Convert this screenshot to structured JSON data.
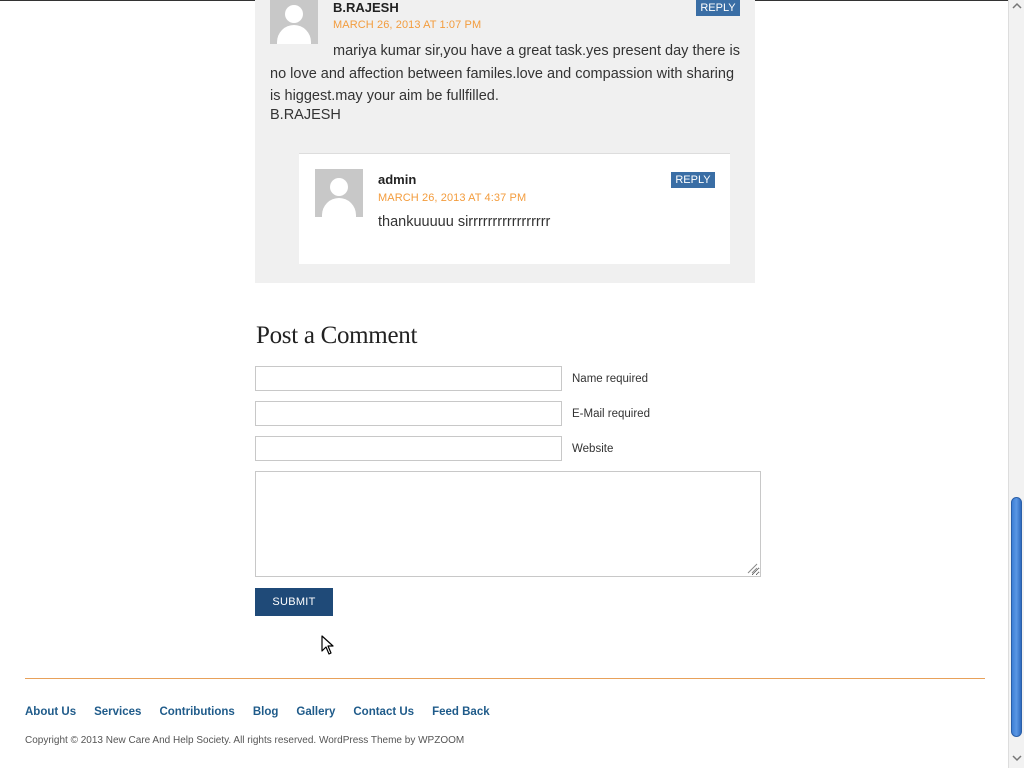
{
  "comments": [
    {
      "author": "B.RAJESH",
      "date": "MARCH 26, 2013 AT 1:07 PM",
      "reply_label": "REPLY",
      "text": "mariya kumar sir,you have a great task.yes present day there is no love and affection between familes.love and compassion with sharing is higgest.may your aim be fullfilled.",
      "signature": "B.RAJESH"
    },
    {
      "author": "admin",
      "date": "MARCH 26, 2013 AT 4:37 PM",
      "reply_label": "REPLY",
      "text": "thankuuuuu sirrrrrrrrrrrrrrrrr"
    }
  ],
  "form": {
    "title": "Post a Comment",
    "name_label": "Name required",
    "email_label": "E-Mail required",
    "website_label": "Website",
    "name_value": "",
    "email_value": "",
    "website_value": "",
    "message_value": "",
    "submit_label": "SUBMIT"
  },
  "footer": {
    "nav": [
      "About Us",
      "Services",
      "Contributions",
      "Blog",
      "Gallery",
      "Contact Us",
      "Feed Back"
    ],
    "copyright": "Copyright © 2013 New Care And Help Society. All rights reserved. WordPress Theme by WPZOOM"
  },
  "colors": {
    "accent_orange": "#f39c3d",
    "reply_blue": "#3a6ea5",
    "submit_blue": "#1f4a78",
    "link_blue": "#1f5b8a"
  }
}
